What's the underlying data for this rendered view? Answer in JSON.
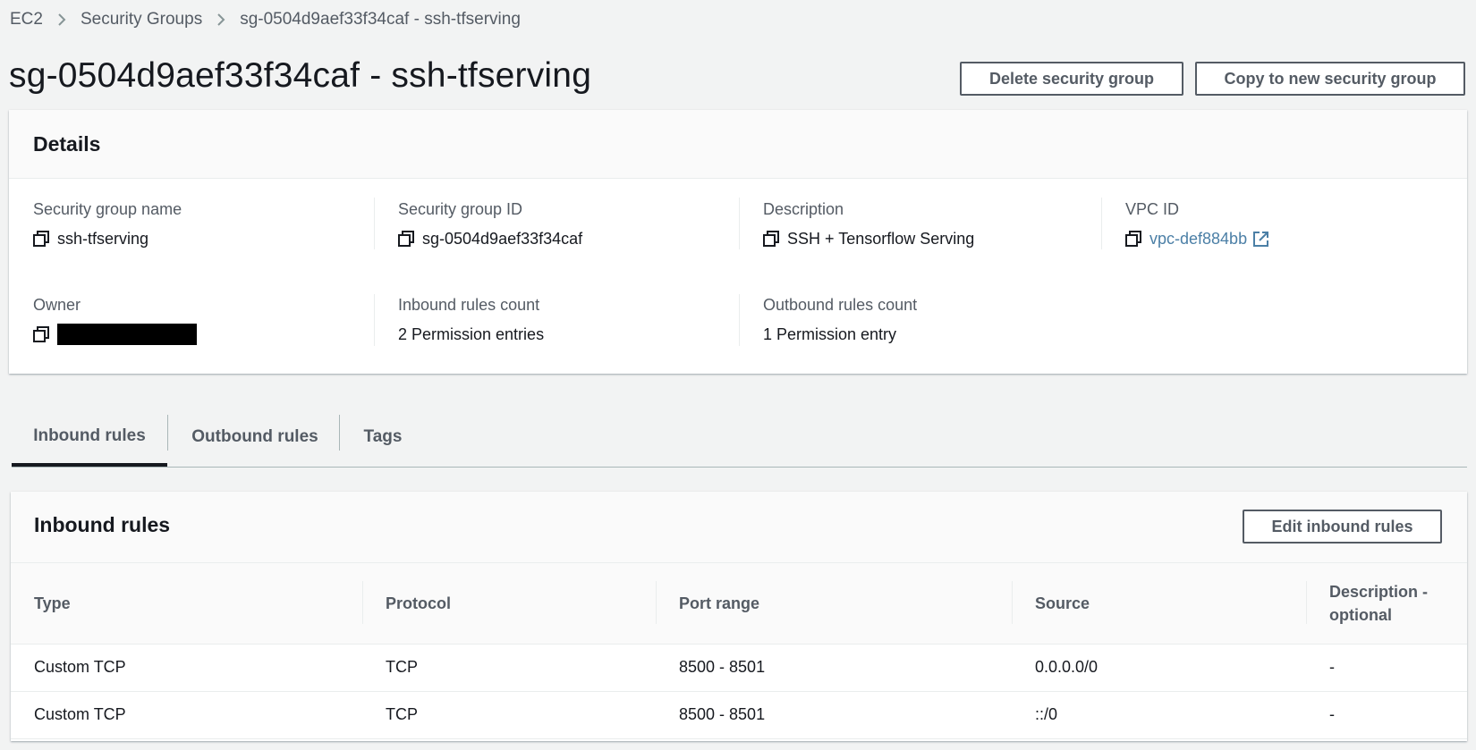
{
  "breadcrumb": {
    "items": [
      "EC2",
      "Security Groups"
    ],
    "current": "sg-0504d9aef33f34caf - ssh-tfserving"
  },
  "page": {
    "title": "sg-0504d9aef33f34caf - ssh-tfserving",
    "delete_button": "Delete security group",
    "copy_button": "Copy to new security group"
  },
  "details": {
    "title": "Details",
    "sg_name_label": "Security group name",
    "sg_name_value": "ssh-tfserving",
    "sg_id_label": "Security group ID",
    "sg_id_value": "sg-0504d9aef33f34caf",
    "description_label": "Description",
    "description_value": "SSH + Tensorflow Serving",
    "vpc_label": "VPC ID",
    "vpc_value": "vpc-def884bb",
    "owner_label": "Owner",
    "inbound_count_label": "Inbound rules count",
    "inbound_count_value": "2 Permission entries",
    "outbound_count_label": "Outbound rules count",
    "outbound_count_value": "1 Permission entry"
  },
  "tabs": [
    "Inbound rules",
    "Outbound rules",
    "Tags"
  ],
  "inbound": {
    "title": "Inbound rules",
    "edit_button": "Edit inbound rules",
    "columns": [
      "Type",
      "Protocol",
      "Port range",
      "Source",
      "Description - optional"
    ],
    "rows": [
      [
        "Custom TCP",
        "TCP",
        "8500 - 8501",
        "0.0.0.0/0",
        "-"
      ],
      [
        "Custom TCP",
        "TCP",
        "8500 - 8501",
        "::/0",
        "-"
      ]
    ]
  },
  "colors": {
    "background": "#f2f3f3",
    "link": "#4b7fa6",
    "border": "#545b64"
  }
}
